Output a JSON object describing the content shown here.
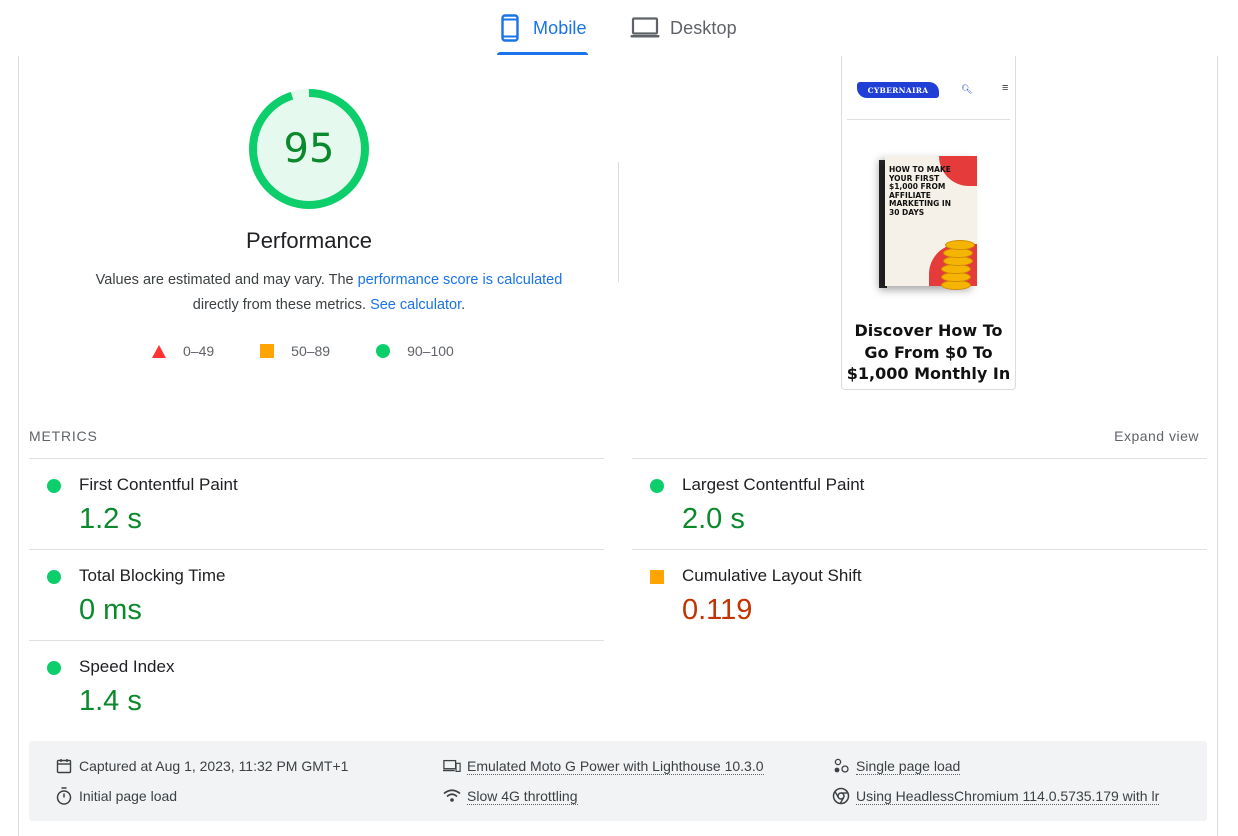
{
  "tabs": {
    "mobile": "Mobile",
    "desktop": "Desktop",
    "active": "Mobile"
  },
  "performance": {
    "score": "95",
    "score_fraction": 0.95,
    "title": "Performance",
    "desc_prefix": "Values are estimated and may vary. The ",
    "desc_link": "performance score is calculated",
    "desc_middle": "directly from these metrics. ",
    "desc_calc_link": "See calculator",
    "desc_suffix": "."
  },
  "legend": [
    {
      "range": "0–49",
      "icon": "red-triangle-icon",
      "color": "#ff3333"
    },
    {
      "range": "50–89",
      "icon": "orange-square-icon",
      "color": "#ffa400"
    },
    {
      "range": "90–100",
      "icon": "green-circle-icon",
      "color": "#0cce6b"
    }
  ],
  "screenshot": {
    "brand": "CYBERNAIRA",
    "book_title": "HOW TO MAKE YOUR FIRST $1,000 FROM AFFILIATE MARKETING IN 30 DAYS",
    "headline": "Discover How To Go From $0 To $1,000 Monthly In"
  },
  "metrics": {
    "section_title": "METRICS",
    "expand_label": "Expand view",
    "items": [
      {
        "label": "First Contentful Paint",
        "value": "1.2 s",
        "status": "good"
      },
      {
        "label": "Largest Contentful Paint",
        "value": "2.0 s",
        "status": "good"
      },
      {
        "label": "Total Blocking Time",
        "value": "0 ms",
        "status": "good"
      },
      {
        "label": "Cumulative Layout Shift",
        "value": "0.119",
        "status": "average"
      },
      {
        "label": "Speed Index",
        "value": "1.4 s",
        "status": "good"
      }
    ]
  },
  "runtime": {
    "captured": "Captured at Aug 1, 2023, 11:32 PM GMT+1",
    "initial_load": "Initial page load",
    "device": "Emulated Moto G Power with Lighthouse 10.3.0",
    "throttling": "Slow 4G throttling",
    "single_load": "Single page load",
    "browser": "Using HeadlessChromium 114.0.5735.179 with lr"
  },
  "colors": {
    "accent": "#1a73e8",
    "good": "#0cce6b",
    "good_text": "#0a8a2c",
    "average": "#ffa400",
    "average_text": "#c33300",
    "poor": "#ff3333"
  }
}
